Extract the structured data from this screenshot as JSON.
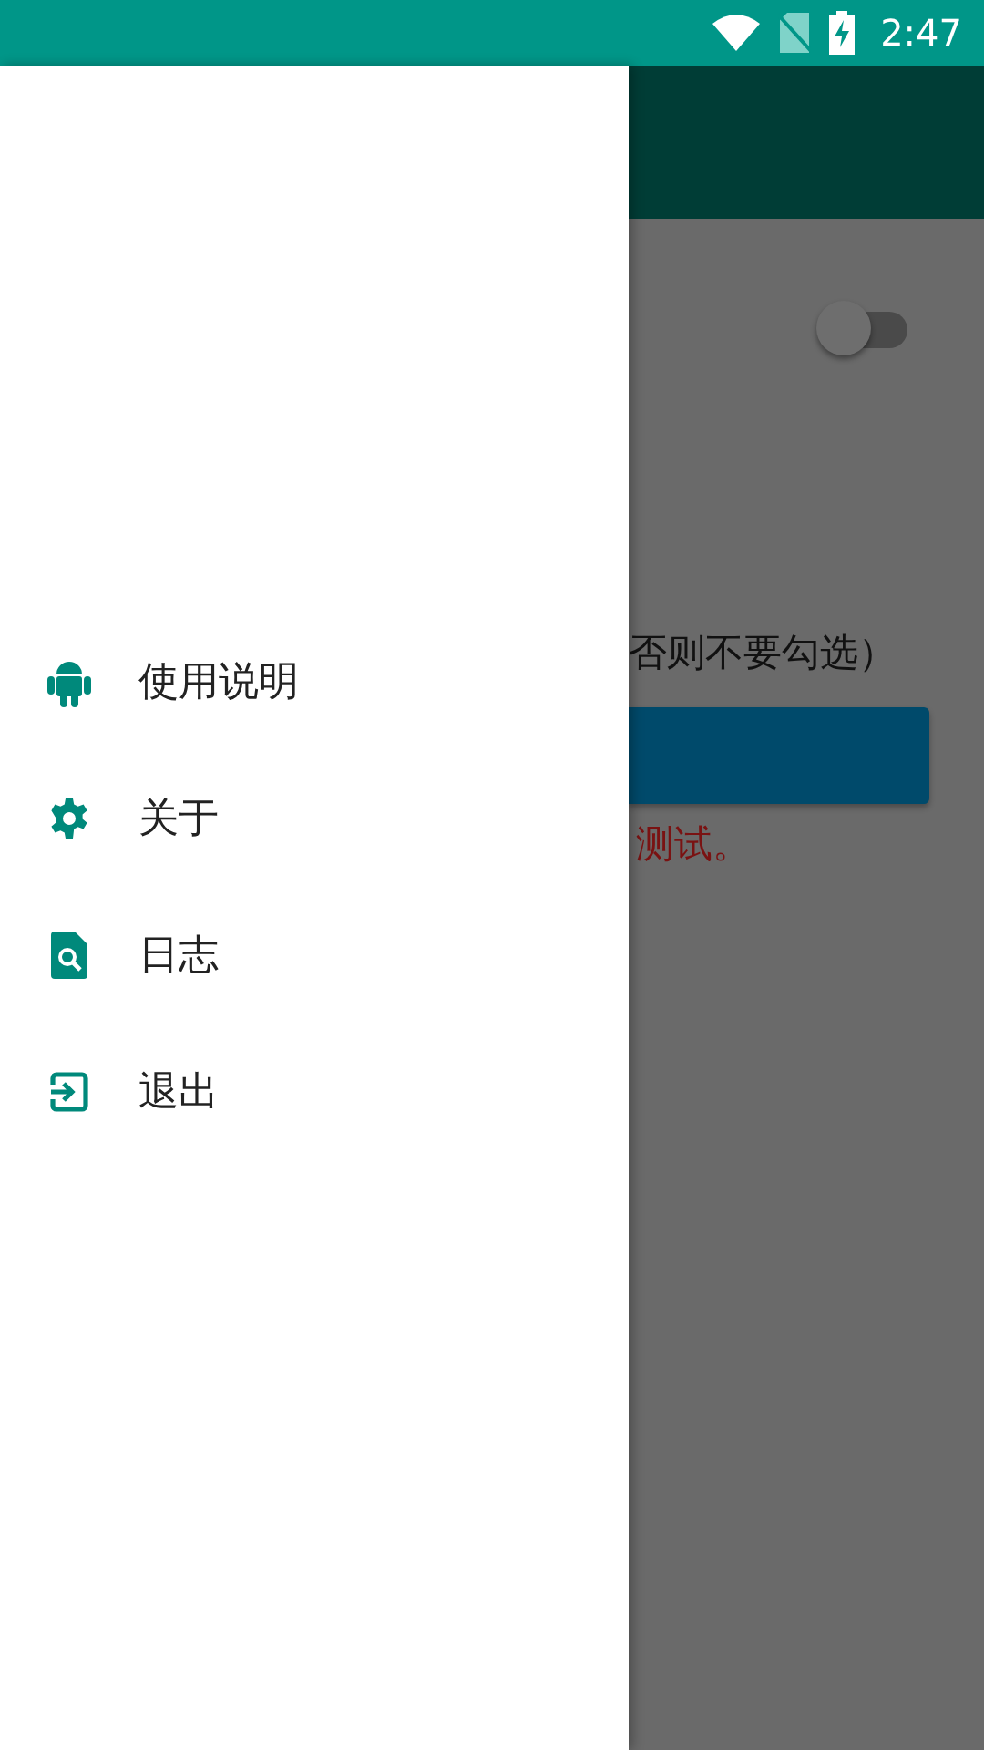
{
  "status_bar": {
    "time": "2:47"
  },
  "drawer": {
    "items": [
      {
        "kind": "android",
        "label": "使用说明"
      },
      {
        "kind": "settings",
        "label": "关于"
      },
      {
        "kind": "log",
        "label": "日志"
      },
      {
        "kind": "exit",
        "label": "退出"
      }
    ]
  },
  "main": {
    "switch": {
      "on": false
    },
    "hint": "否则不要勾选）",
    "warning": "测试。"
  }
}
